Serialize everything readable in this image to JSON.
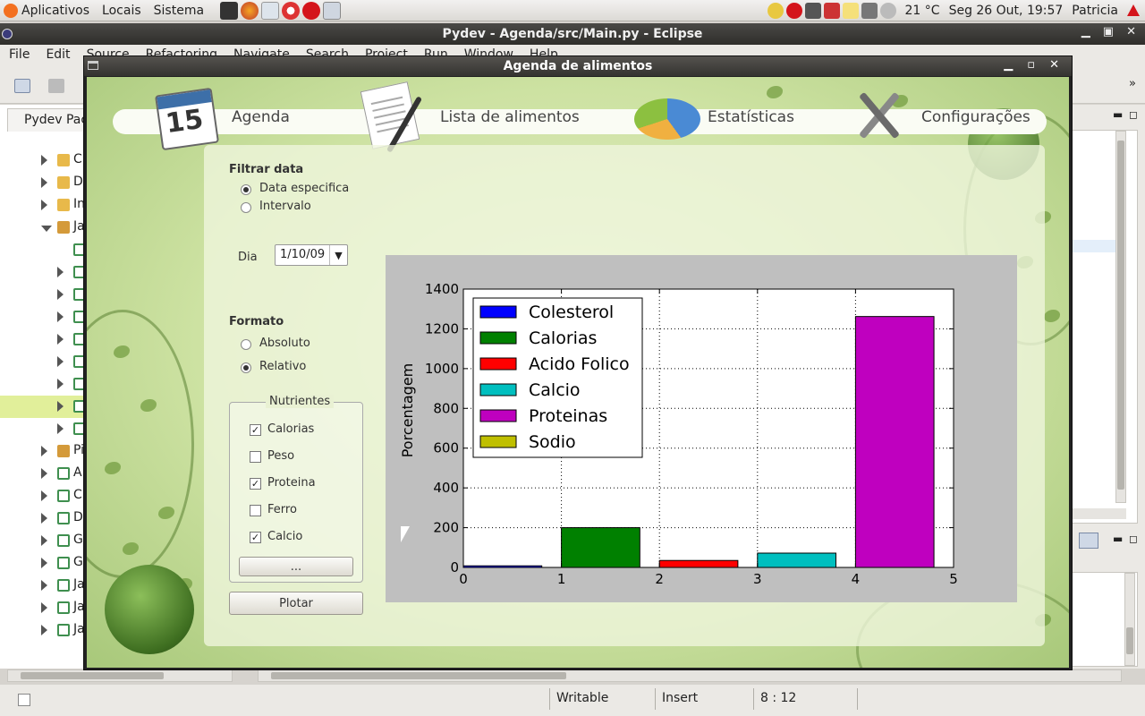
{
  "gnome_panel": {
    "menus": [
      "Aplicativos",
      "Locais",
      "Sistema"
    ],
    "weather": "21 °C",
    "datetime": "Seg 26 Out, 19:57",
    "user": "Patricia"
  },
  "eclipse": {
    "title": "Pydev - Agenda/src/Main.py - Eclipse",
    "menu": [
      "File",
      "Edit",
      "Source",
      "Refactoring",
      "Navigate",
      "Search",
      "Project",
      "Run",
      "Window",
      "Help"
    ],
    "package_tab": "Pydev Pac",
    "tree": [
      {
        "label": "C",
        "indent": 1,
        "type": "folder",
        "arrow": "closed"
      },
      {
        "label": "D",
        "indent": 1,
        "type": "folder",
        "arrow": "closed"
      },
      {
        "label": "In",
        "indent": 1,
        "type": "folder",
        "arrow": "closed"
      },
      {
        "label": "Ja",
        "indent": 1,
        "type": "pkg",
        "arrow": "open"
      },
      {
        "label": "",
        "indent": 2,
        "type": "py",
        "arrow": "none"
      },
      {
        "label": "",
        "indent": 2,
        "type": "py",
        "arrow": "closed"
      },
      {
        "label": "",
        "indent": 2,
        "type": "py",
        "arrow": "closed"
      },
      {
        "label": "",
        "indent": 2,
        "type": "py",
        "arrow": "closed"
      },
      {
        "label": "",
        "indent": 2,
        "type": "py",
        "arrow": "closed"
      },
      {
        "label": "",
        "indent": 2,
        "type": "py",
        "arrow": "closed"
      },
      {
        "label": "",
        "indent": 2,
        "type": "py",
        "arrow": "closed"
      },
      {
        "label": "",
        "indent": 2,
        "type": "py",
        "arrow": "closed",
        "selected": true
      },
      {
        "label": "",
        "indent": 2,
        "type": "py",
        "arrow": "closed"
      },
      {
        "label": "Pi",
        "indent": 1,
        "type": "pkg",
        "arrow": "closed"
      },
      {
        "label": "A",
        "indent": 1,
        "type": "py",
        "arrow": "closed"
      },
      {
        "label": "C",
        "indent": 1,
        "type": "py",
        "arrow": "closed"
      },
      {
        "label": "D",
        "indent": 1,
        "type": "py",
        "arrow": "closed"
      },
      {
        "label": "G",
        "indent": 1,
        "type": "py",
        "arrow": "closed"
      },
      {
        "label": "G",
        "indent": 1,
        "type": "py",
        "arrow": "closed"
      },
      {
        "label": "Ja",
        "indent": 1,
        "type": "py",
        "arrow": "closed"
      },
      {
        "label": "Ja",
        "indent": 1,
        "type": "py",
        "arrow": "closed"
      },
      {
        "label": "Ja",
        "indent": 1,
        "type": "py",
        "arrow": "closed"
      }
    ],
    "status": {
      "writable": "Writable",
      "insert": "Insert",
      "position": "8 : 12"
    }
  },
  "dialog": {
    "title": "Agenda de alimentos",
    "nav": {
      "agenda": "Agenda",
      "calendar_day": "15",
      "lista": "Lista de alimentos",
      "estatisticas": "Estatísticas",
      "config": "Configurações"
    },
    "filtrar_data": {
      "title": "Filtrar data",
      "opt_especifica": "Data especifica",
      "opt_intervalo": "Intervalo",
      "selected": "especifica"
    },
    "dia": {
      "label": "Dia",
      "value": "1/10/09"
    },
    "formato": {
      "title": "Formato",
      "opt_absoluto": "Absoluto",
      "opt_relativo": "Relativo",
      "selected": "relativo"
    },
    "nutrientes": {
      "title": "Nutrientes",
      "items": [
        {
          "label": "Calorias",
          "checked": true
        },
        {
          "label": "Peso",
          "checked": false
        },
        {
          "label": "Proteina",
          "checked": true
        },
        {
          "label": "Ferro",
          "checked": false
        },
        {
          "label": "Calcio",
          "checked": true
        }
      ],
      "more_button": "...",
      "plot_button": "Plotar"
    }
  },
  "chart_data": {
    "type": "bar",
    "ylabel": "Porcentagem",
    "xlabel": "",
    "xlim": [
      0,
      5
    ],
    "ylim": [
      0,
      1400
    ],
    "xticks": [
      0,
      1,
      2,
      3,
      4,
      5
    ],
    "yticks": [
      0,
      200,
      400,
      600,
      800,
      1000,
      1200,
      1400
    ],
    "grid": true,
    "legend_position": "top-left",
    "bar_width": 0.8,
    "series": [
      {
        "name": "Colesterol",
        "x": 0,
        "value": 8,
        "color": "#0000ff"
      },
      {
        "name": "Calorias",
        "x": 1,
        "value": 200,
        "color": "#008000"
      },
      {
        "name": "Acido Folico",
        "x": 2,
        "value": 35,
        "color": "#ff0000"
      },
      {
        "name": "Calcio",
        "x": 3,
        "value": 72,
        "color": "#00bfbf"
      },
      {
        "name": "Proteinas",
        "x": 4,
        "value": 1262,
        "color": "#bf00bf"
      },
      {
        "name": "Sodio",
        "x": 5,
        "value": 0,
        "color": "#bfbf00"
      }
    ]
  }
}
